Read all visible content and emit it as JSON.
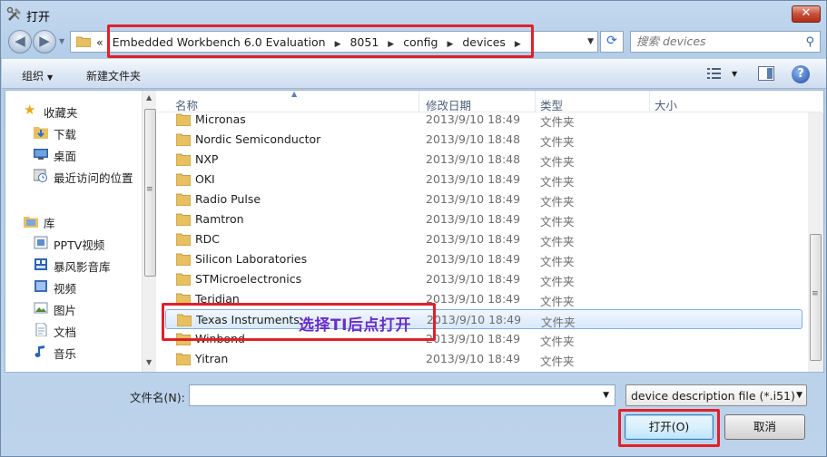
{
  "window": {
    "title": "打开",
    "close_label": "✕"
  },
  "address_bar": {
    "prefix": "«",
    "crumbs": [
      "Embedded Workbench 6.0 Evaluation",
      "8051",
      "config",
      "devices"
    ]
  },
  "search": {
    "placeholder": "搜索 devices"
  },
  "toolbar": {
    "organize_label": "组织",
    "new_folder_label": "新建文件夹"
  },
  "nav_pane": {
    "favorites_label": "收藏夹",
    "favorites": [
      "下载",
      "桌面",
      "最近访问的位置"
    ],
    "libraries_label": "库",
    "libraries": [
      "PPTV视频",
      "暴风影音库",
      "视频",
      "图片",
      "文档",
      "音乐"
    ]
  },
  "columns": {
    "name": "名称",
    "date": "修改日期",
    "type": "类型",
    "size": "大小"
  },
  "files": [
    {
      "name": "Micronas",
      "date": "2013/9/10 18:49",
      "type": "文件夹"
    },
    {
      "name": "Nordic Semiconductor",
      "date": "2013/9/10 18:48",
      "type": "文件夹"
    },
    {
      "name": "NXP",
      "date": "2013/9/10 18:48",
      "type": "文件夹"
    },
    {
      "name": "OKI",
      "date": "2013/9/10 18:49",
      "type": "文件夹"
    },
    {
      "name": "Radio Pulse",
      "date": "2013/9/10 18:49",
      "type": "文件夹"
    },
    {
      "name": "Ramtron",
      "date": "2013/9/10 18:49",
      "type": "文件夹"
    },
    {
      "name": "RDC",
      "date": "2013/9/10 18:49",
      "type": "文件夹"
    },
    {
      "name": "Silicon Laboratories",
      "date": "2013/9/10 18:49",
      "type": "文件夹"
    },
    {
      "name": "STMicroelectronics",
      "date": "2013/9/10 18:49",
      "type": "文件夹"
    },
    {
      "name": "Teridian",
      "date": "2013/9/10 18:49",
      "type": "文件夹"
    },
    {
      "name": "Texas Instruments",
      "date": "2013/9/10 18:49",
      "type": "文件夹",
      "selected": true
    },
    {
      "name": "Winbond",
      "date": "2013/9/10 18:49",
      "type": "文件夹"
    },
    {
      "name": "Yitran",
      "date": "2013/9/10 18:49",
      "type": "文件夹"
    }
  ],
  "annotation": "选择TI后点打开",
  "filename": {
    "label": "文件名(N):",
    "value": ""
  },
  "filter": {
    "selected": "device description file (*.i51)"
  },
  "buttons": {
    "open": "打开(O)",
    "cancel": "取消"
  },
  "colors": {
    "highlight_box": "#e0202b",
    "annotation_text": "#6a2ec8",
    "folder": "#e8c060"
  }
}
